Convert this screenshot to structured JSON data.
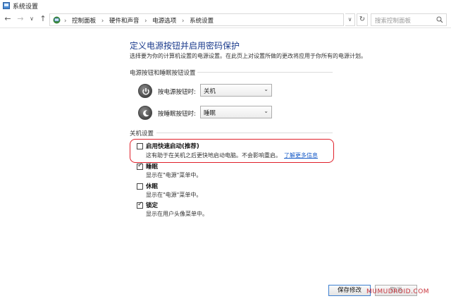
{
  "window": {
    "title": "系统设置"
  },
  "address": {
    "breadcrumbs": [
      "控制面板",
      "硬件和声音",
      "电源选项",
      "系统设置"
    ],
    "search_placeholder": "搜索控制面板"
  },
  "page": {
    "heading": "定义电源按钮并启用密码保护",
    "description": "选择要为你的计算机设置的电源设置。在此页上对设置所做的更改将应用于你所有的电源计划。"
  },
  "power_section": {
    "title": "电源按钮和睡眠按钮设置",
    "power_button": {
      "label": "按电源按钮时:",
      "value": "关机"
    },
    "sleep_button": {
      "label": "按睡眠按钮时:",
      "value": "睡眠"
    }
  },
  "shutdown_section": {
    "title": "关机设置",
    "options": [
      {
        "label": "启用快速启动(推荐)",
        "desc": "这有助于在关机之后更快地启动电脑。不会影响重启。",
        "link": "了解更多信息",
        "checked": false
      },
      {
        "label": "睡眠",
        "desc": "显示在\"电源\"菜单中。",
        "checked": true
      },
      {
        "label": "休眠",
        "desc": "显示在\"电源\"菜单中。",
        "checked": false
      },
      {
        "label": "锁定",
        "desc": "显示在用户头像菜单中。",
        "checked": true
      }
    ]
  },
  "footer": {
    "save_label": "保存修改",
    "cancel_label": "取消",
    "watermark": "MUMUDROID.COM"
  },
  "colors": {
    "heading": "#1a3a8c",
    "link": "#1a5dc8",
    "highlight": "#e0202a"
  }
}
